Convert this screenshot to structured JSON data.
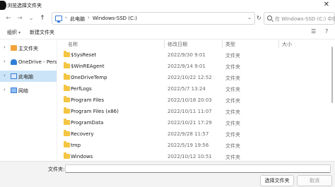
{
  "window": {
    "title": "浏览选择文件夹",
    "close_glyph": "✕"
  },
  "address": {
    "crumbs": [
      "此电脑",
      "Windows-SSD (C:)"
    ],
    "separator": "›",
    "dropdown_glyph": "⌄",
    "search_placeholder": "在 Windows-SSD (C:) 中搜索"
  },
  "nav_buttons": {
    "back": "←",
    "forward": "→",
    "dropdown": "⌄",
    "up": "↑",
    "refresh": "↻"
  },
  "toolbar": {
    "organize": "组织",
    "new_folder": "新建文件夹",
    "view_glyph": "☰",
    "help_glyph": "?"
  },
  "sidebar": {
    "items": [
      {
        "label": "主文件夹",
        "chevron": "›",
        "icon": "home-icon"
      },
      {
        "label": "OneDrive - Personal",
        "chevron": "›",
        "icon": "cloud-icon"
      },
      {
        "label": "此电脑",
        "chevron": "›",
        "icon": "pc-icon"
      },
      {
        "label": "网络",
        "chevron": "›",
        "icon": "network-icon"
      }
    ]
  },
  "columns": {
    "name": "名称",
    "date": "修改日期",
    "type": "类型",
    "size": "大小"
  },
  "files": [
    {
      "name": "$SysReset",
      "date": "2022/9/30 9:01",
      "type": "文件夹"
    },
    {
      "name": "$WinREAgent",
      "date": "2022/9/14 9:01",
      "type": "文件夹"
    },
    {
      "name": "OneDriveTemp",
      "date": "2022/10/22 12:52",
      "type": "文件夹"
    },
    {
      "name": "PerfLogs",
      "date": "2022/5/7 13:24",
      "type": "文件夹"
    },
    {
      "name": "Program Files",
      "date": "2022/10/18 20:03",
      "type": "文件夹"
    },
    {
      "name": "Program Files (x86)",
      "date": "2022/10/11 11:07",
      "type": "文件夹"
    },
    {
      "name": "ProgramData",
      "date": "2022/10/21 17:29",
      "type": "文件夹"
    },
    {
      "name": "Recovery",
      "date": "2022/9/28 11:57",
      "type": "文件夹"
    },
    {
      "name": "tmp",
      "date": "2022/5/19 19:56",
      "type": "文件夹"
    },
    {
      "name": "Windows",
      "date": "2022/10/12 10:51",
      "type": "文件夹"
    }
  ],
  "footer": {
    "folder_label": "文件夹:",
    "folder_value": "",
    "select_button": "选择文件夹",
    "cancel_button": "取消"
  },
  "colors": {
    "selected_nav": "#cce4f7",
    "folder": "#f4c542",
    "accent": "#3a7bd5"
  }
}
